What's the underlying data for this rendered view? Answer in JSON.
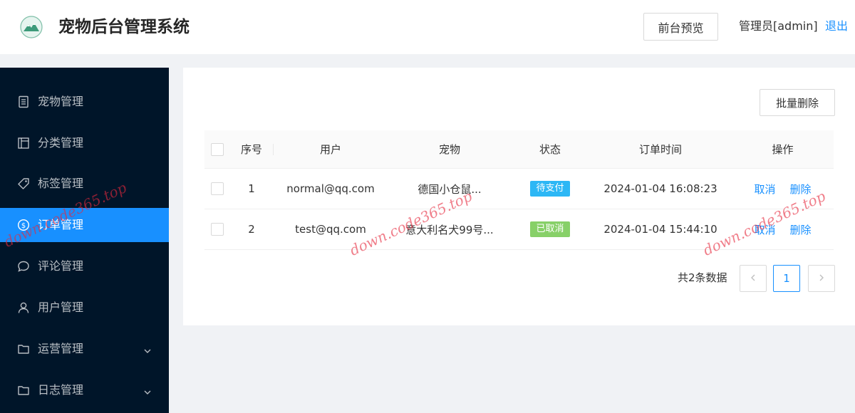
{
  "header": {
    "title": "宠物后台管理系统",
    "logo_icon": "mountain-logo-icon",
    "preview_label": "前台预览",
    "admin_label": "管理员[admin]",
    "logout_label": "退出"
  },
  "sidebar": {
    "items": [
      {
        "label": "宠物管理",
        "icon": "file-icon",
        "active": false
      },
      {
        "label": "分类管理",
        "icon": "layout-icon",
        "active": false
      },
      {
        "label": "标签管理",
        "icon": "tag-icon",
        "active": false
      },
      {
        "label": "订单管理",
        "icon": "dollar-circle-icon",
        "active": true
      },
      {
        "label": "评论管理",
        "icon": "comment-icon",
        "active": false
      },
      {
        "label": "用户管理",
        "icon": "user-icon",
        "active": false
      },
      {
        "label": "运营管理",
        "icon": "folder-icon",
        "active": false,
        "expandable": true
      },
      {
        "label": "日志管理",
        "icon": "folder-icon",
        "active": false,
        "expandable": true
      }
    ]
  },
  "toolbar": {
    "batch_delete_label": "批量删除"
  },
  "table": {
    "columns": [
      "序号",
      "用户",
      "宠物",
      "状态",
      "订单时间",
      "操作"
    ],
    "rows": [
      {
        "index": "1",
        "user": "normal@qq.com",
        "pet": "德国小仓鼠...",
        "status": "待支付",
        "time": "2024-01-04 16:08:23",
        "action_cancel": "取消",
        "action_delete": "删除"
      },
      {
        "index": "2",
        "user": "test@qq.com",
        "pet": "意大利名犬99号...",
        "status": "已取消",
        "time": "2024-01-04 15:44:10",
        "action_cancel": "取消",
        "action_delete": "删除"
      }
    ]
  },
  "status_colors": {
    "待支付": "#2db7f5",
    "已取消": "#87d068"
  },
  "pagination": {
    "total_label": "共2条数据",
    "current_page": "1",
    "prev_icon": "chevron-left-icon",
    "next_icon": "chevron-right-icon"
  },
  "watermark": {
    "text": "down.code365.top"
  },
  "colors": {
    "accent": "#1890ff",
    "sidebar_bg": "#001529",
    "page_bg": "#f0f2f5"
  }
}
